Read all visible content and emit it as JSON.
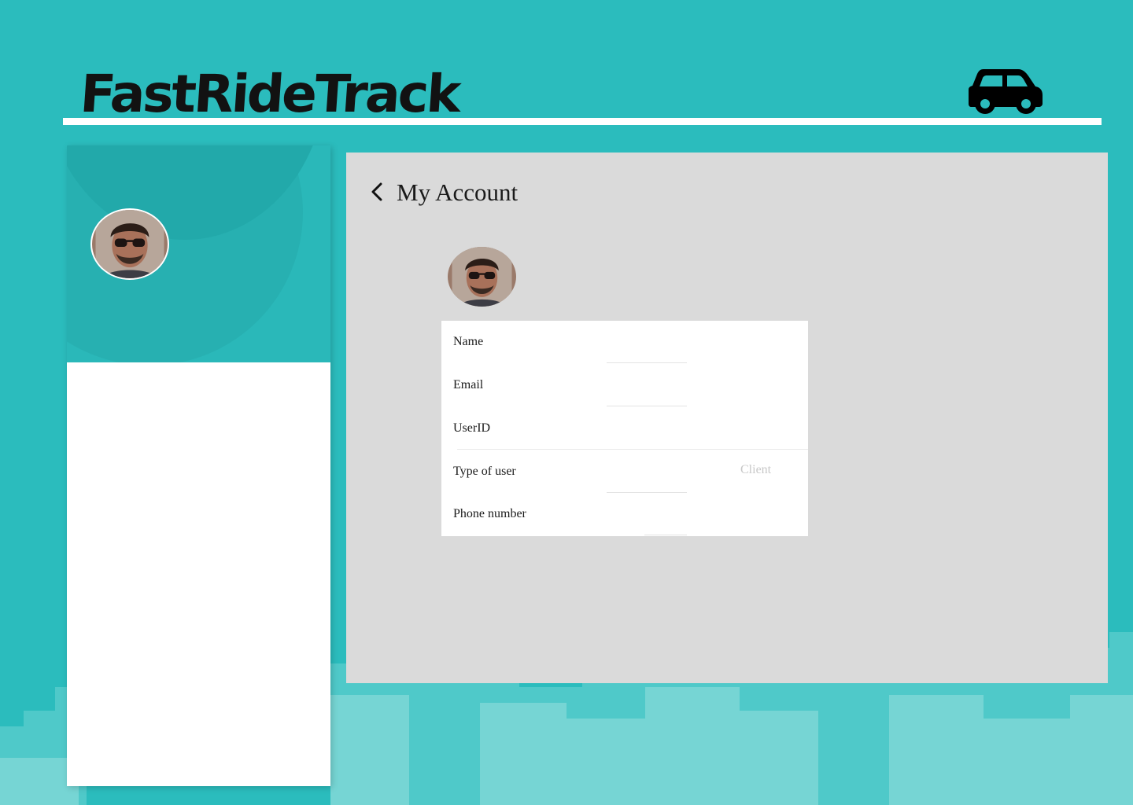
{
  "header": {
    "brand": "FastRideTrack",
    "icon": "car-icon"
  },
  "sidebar": {
    "avatar_icon": "user-avatar"
  },
  "account": {
    "title": "My Account",
    "back_icon": "chevron-left-icon",
    "fields": [
      {
        "label": "Name",
        "value": ""
      },
      {
        "label": "Email",
        "value": ""
      },
      {
        "label": "UserID",
        "value": ""
      },
      {
        "label": "Type of user",
        "value": "Client"
      },
      {
        "label": "Phone number",
        "value": ""
      }
    ]
  },
  "colors": {
    "background": "#2bbcbd",
    "panel": "#dadada",
    "text": "#1a1a1a",
    "placeholder": "#c8c8c8"
  }
}
